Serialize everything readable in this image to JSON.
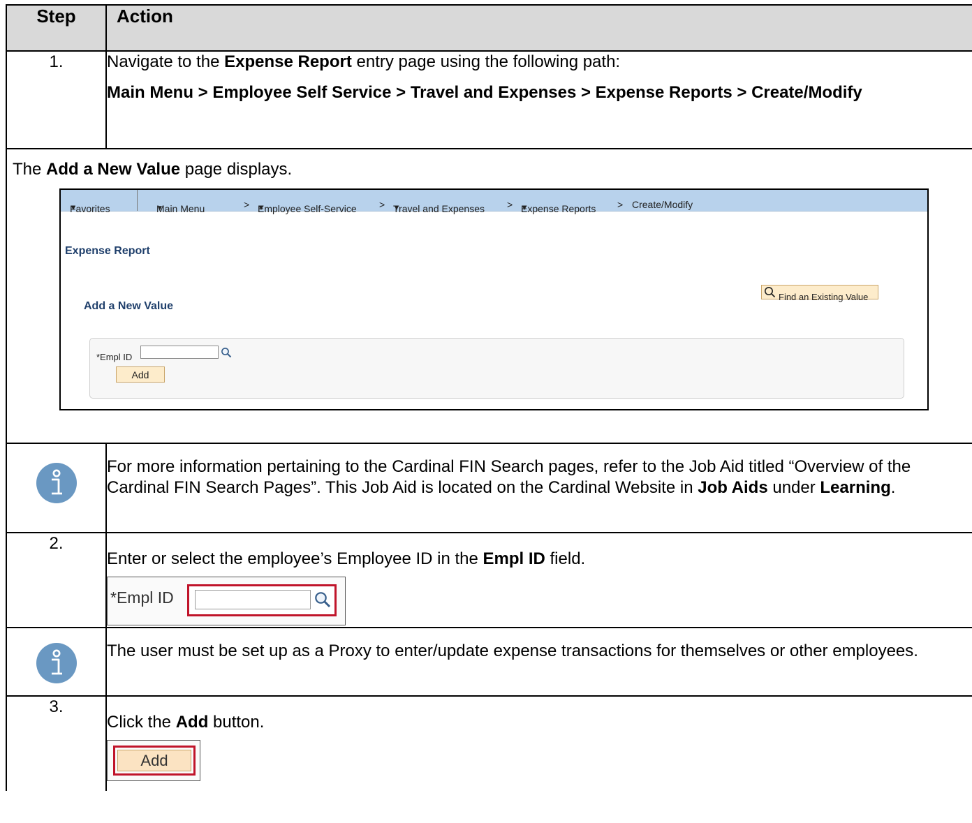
{
  "table": {
    "header": {
      "step": "Step",
      "action": "Action"
    },
    "row1": {
      "step": "1.",
      "text_a": "Navigate to the ",
      "text_b": "Expense Report",
      "text_c": " entry page using the following path:",
      "path": "Main Menu > Employee Self Service > Travel and Expenses > Expense Reports > Create/Modify"
    },
    "note1": {
      "a": "The ",
      "b": "Add a New Value",
      "c": " page displays."
    },
    "info1": {
      "a": "For more information pertaining to the Cardinal FIN Search pages, refer to the Job Aid titled “Overview of the Cardinal FIN Search Pages”.  This Job Aid is located on the Cardinal Website in ",
      "b": "Job Aids",
      "c": " under ",
      "d": "Learning",
      "e": "."
    },
    "row2": {
      "step": "2.",
      "a": "Enter or select the employee’s Employee ID in the ",
      "b": "Empl ID",
      "c": " field."
    },
    "info2": {
      "text": "The user must be set up as a Proxy to enter/update expense transactions for themselves or other employees."
    },
    "row3": {
      "step": "3.",
      "a": "Click the ",
      "b": "Add",
      "c": " button."
    }
  },
  "screenshot1": {
    "nav": {
      "favorites": "Favorites",
      "main_menu": "Main Menu",
      "employee_self_service": "Employee Self-Service",
      "travel_and_expenses": "Travel and Expenses",
      "expense_reports": "Expense Reports",
      "create_modify": "Create/Modify",
      "separator": ">",
      "caret": "▼"
    },
    "page_title": "Expense Report",
    "section_title": "Add a New Value",
    "find_button": "Find an Existing Value",
    "empl_id_label": "*Empl ID",
    "empl_id_value": "",
    "add_button": "Add"
  },
  "screenshot2": {
    "label": "*Empl ID",
    "value": ""
  },
  "screenshot3": {
    "add_button": "Add"
  },
  "colors": {
    "header_bg": "#d9d9d9",
    "nav_bg": "#b8d2ec",
    "title_color": "#1f3f6b",
    "button_bg": "#fdeccb",
    "highlight_red": "#c0142a",
    "info_icon_blue": "#6a98c2"
  },
  "icons": {
    "info": "info-icon",
    "lookup": "magnifier-icon"
  }
}
